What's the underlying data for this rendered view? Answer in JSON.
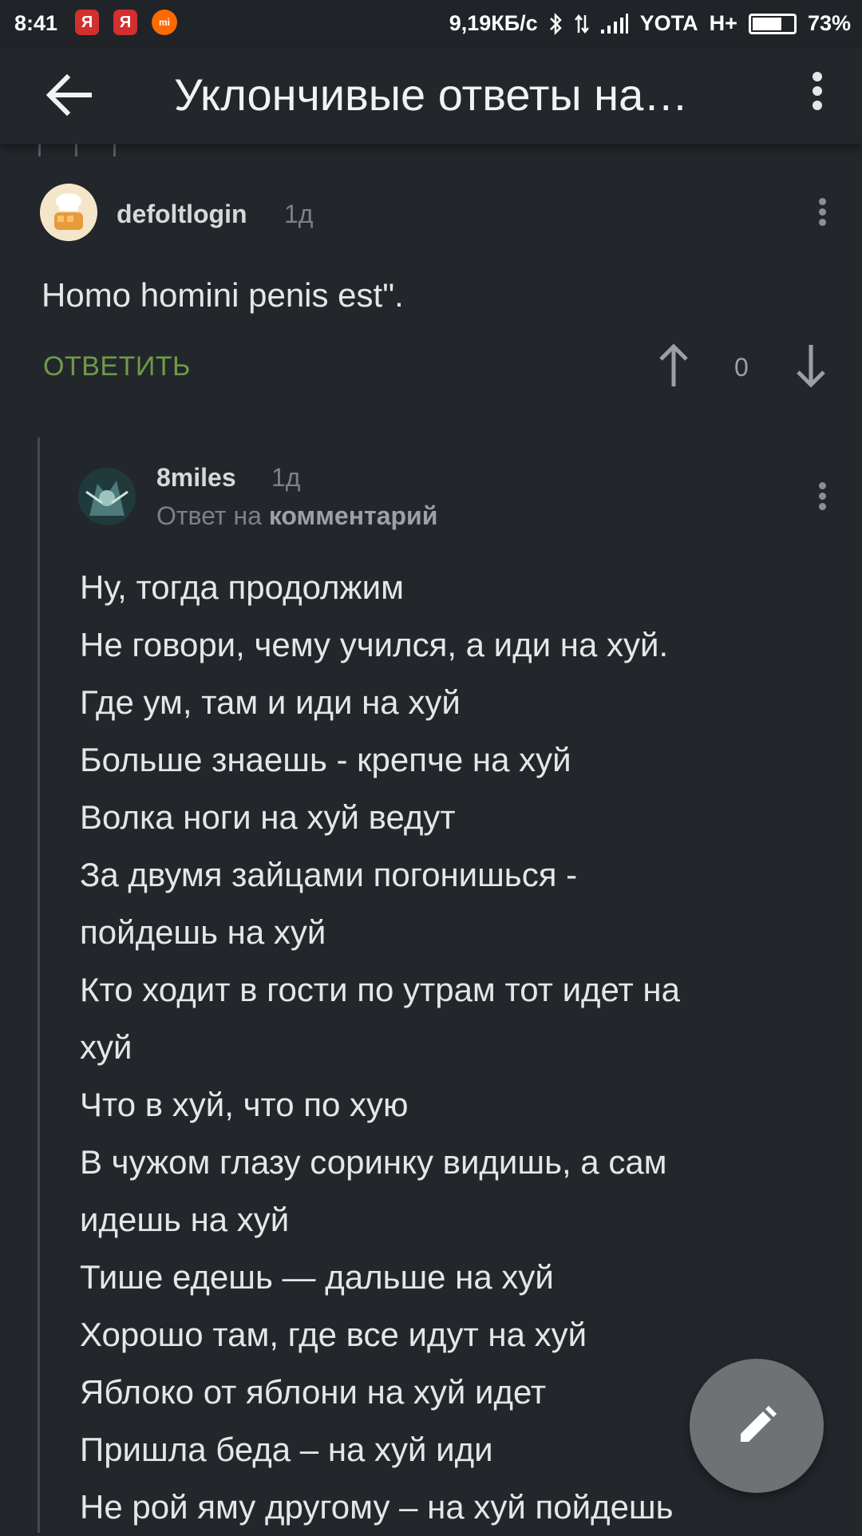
{
  "status_bar": {
    "time": "8:41",
    "notif_ya_1": "Я",
    "notif_ya_2": "Я",
    "notif_mi": "mi",
    "net_speed": "9,19КБ/с",
    "carrier": "YOTA",
    "network": "H+",
    "battery": "73%",
    "battery_level": 0.73
  },
  "toolbar": {
    "title": "Уклончивые ответы на…"
  },
  "comment1": {
    "user": "defoltlogin",
    "time": "1д",
    "text": "Homo homini penis est\".",
    "reply_label": "ОТВЕТИТЬ",
    "votes": "0"
  },
  "comment2": {
    "user": "8miles",
    "time": "1д",
    "reply_prefix": "Ответ на",
    "reply_target": "комментарий",
    "lines": [
      "Ну, тогда продолжим",
      "Не говори, чему учился, а иди на хуй.",
      "Где ум, там и иди на хуй",
      "Больше знаешь - крепче на хуй",
      "Волка ноги на хуй ведут",
      "За двумя зайцами погонишься -",
      "пойдешь на хуй",
      "Кто ходит в гости по утрам тот идет на",
      "хуй",
      "Что в хуй, что по хую",
      "В чужом глазу соринку видишь, а сам",
      "идешь на хуй",
      "Тише едешь — дальше на хуй",
      "Хорошо там, где все идут на хуй",
      "Яблоко от яблони на хуй идет",
      "Пришла беда – на хуй иди",
      "Не рой яму другому – на хуй пойдешь"
    ]
  },
  "colors": {
    "background": "#23272c",
    "accent_green": "#6f9a4a",
    "fab": "#6f7275"
  }
}
